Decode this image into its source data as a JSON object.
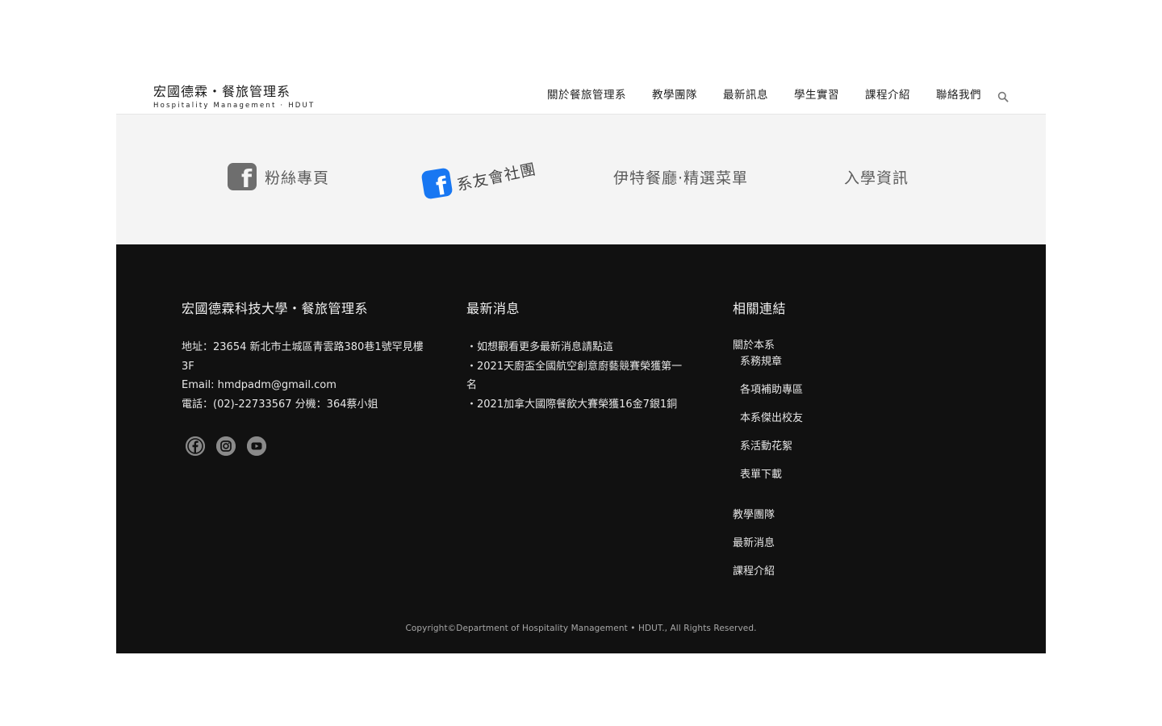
{
  "header": {
    "logo_title": "宏國德霖・餐旅管理系",
    "logo_subtitle": "Hospitality Management · HDUT",
    "nav": [
      {
        "label": "關於餐旅管理系"
      },
      {
        "label": "教學團隊"
      },
      {
        "label": "最新訊息"
      },
      {
        "label": "學生實習"
      },
      {
        "label": "課程介紹"
      },
      {
        "label": "聯絡我們"
      }
    ],
    "search_icon": "search-icon"
  },
  "quick_links": {
    "fans": {
      "icon": "facebook-icon",
      "label": "粉絲專頁"
    },
    "alumni": {
      "icon": "facebook-icon",
      "label": "系友會社團"
    },
    "menu": {
      "label": "伊特餐廳‧精選菜單"
    },
    "admission": {
      "label": "入學資訊"
    }
  },
  "footer": {
    "school": {
      "heading": "宏國德霖科技大學・餐旅管理系",
      "address": "地址：23654 新北市土城區青雲路380巷1號罕見樓3F",
      "email": "Email: hmdpadm@gmail.com",
      "phone": "電話：(02)-22733567 分機：364蔡小姐"
    },
    "social": [
      "facebook-icon",
      "instagram-icon",
      "youtube-icon"
    ],
    "news": {
      "heading": "最新消息",
      "items": [
        "・如想觀看更多最新消息請點這",
        "・2021天廚盃全國航空創意廚藝競賽榮獲第一名",
        "・2021加拿大國際餐飲大賽榮獲16金7銀1銅"
      ]
    },
    "links": {
      "heading": "相關連結",
      "about": "關於本系",
      "about_sub": [
        "系務規章",
        "各項補助專區",
        "本系傑出校友",
        "系活動花絮",
        "表單下載"
      ],
      "main": [
        "教學團隊",
        "最新消息",
        "課程介紹"
      ]
    },
    "copyright": "Copyright©Department of Hospitality Management • HDUT., All Rights Reserved."
  },
  "colors": {
    "footer_bg": "#111111",
    "band_bg": "#f4f4f4",
    "facebook_blue": "#1877f2",
    "icon_gray": "#8a8a8a"
  }
}
